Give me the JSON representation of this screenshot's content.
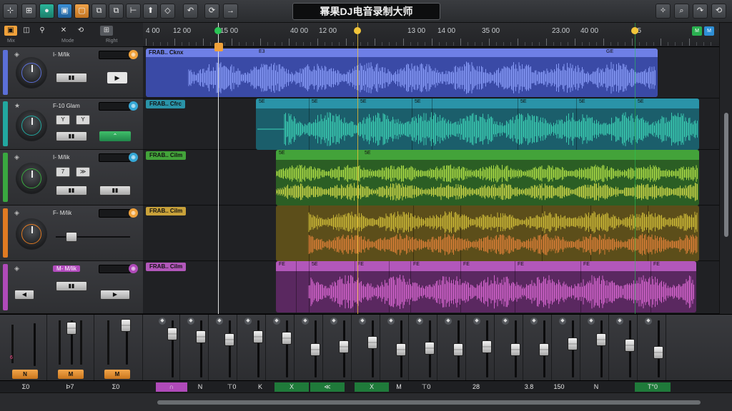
{
  "app": {
    "title": "幂果DJ电音录制大师"
  },
  "toolbar": {
    "left_buttons": [
      {
        "name": "cursor-tool",
        "glyph": "⊹"
      },
      {
        "name": "mixer-tool",
        "glyph": "⊞"
      },
      {
        "name": "record-tool",
        "glyph": "●"
      },
      {
        "name": "video-tool",
        "glyph": "▣"
      },
      {
        "name": "loop-tool",
        "glyph": "▢"
      },
      {
        "name": "copy-tool",
        "glyph": "⧉"
      },
      {
        "name": "paste-tool",
        "glyph": "⧉"
      },
      {
        "name": "split-tool",
        "glyph": "⊢"
      },
      {
        "name": "pin-tool",
        "glyph": "⬆"
      },
      {
        "name": "tag-tool",
        "glyph": "◇"
      },
      {
        "name": "rewind-tool",
        "glyph": "↶"
      },
      {
        "name": "sync-tool",
        "glyph": "⟳"
      },
      {
        "name": "forward-tool",
        "glyph": "→"
      }
    ],
    "right_buttons": [
      {
        "name": "marker-right",
        "glyph": "✧"
      },
      {
        "name": "zoom-right",
        "glyph": "⌕"
      },
      {
        "name": "redo-right",
        "glyph": "↷"
      },
      {
        "name": "undo-right",
        "glyph": "⟲"
      }
    ]
  },
  "header_bar": {
    "labels": [
      "Mix",
      "Mode",
      "Right"
    ]
  },
  "ruler": {
    "labels": [
      "4 00",
      "12 00",
      "15 00",
      "40 00",
      "12 00",
      "13 00",
      "14 00",
      "35 00",
      "23.00",
      "40 00",
      "45"
    ]
  },
  "tracks": [
    {
      "name": "I- M/lik",
      "color": "#5b6fd8",
      "field_badge": "⊕",
      "badge_color": "#f0a13a",
      "clip_label": "FRAB.. Cknx",
      "clip_color": "#5b6fd8",
      "clip_head_color": "#6e7fe6",
      "wave_color": "#8fa2ff"
    },
    {
      "name": "F-10 Glam",
      "color": "#22a8a0",
      "field_badge": "⊕",
      "badge_color": "#36a8d6",
      "clip_label": "FRAB.. Cfrc",
      "clip_color": "#1e6a78",
      "clip_head_color": "#2a93a8",
      "wave_color": "#3ed6b8"
    },
    {
      "name": "I- M/lik",
      "color": "#3aa840",
      "field_badge": "⊕",
      "badge_color": "#36a8d6",
      "clip_label": "FRAB.. Cilm",
      "clip_color": "#2d6e2a",
      "clip_head_color": "#43a33a",
      "wave_color": "#a8e04a"
    },
    {
      "name": "F- M/lik",
      "color": "#e07a22",
      "field_badge": "⊕",
      "badge_color": "#f0a13a",
      "clip_label": "FRAB.. Cilm",
      "clip_color": "#6e5c1e",
      "clip_head_color": "#c9a23a",
      "wave_color": "#e09a2a"
    },
    {
      "name": "M- M/lik",
      "color": "#b04ab9",
      "field_badge": "⊕",
      "badge_color": "#b04ab9",
      "clip_label": "FRAB.. Cilm",
      "clip_color": "#6a2d6e",
      "clip_head_color": "#b257ba",
      "wave_color": "#e06ad8"
    }
  ],
  "track_buttons": {
    "t1_play": "▶",
    "t2_b1": "Y",
    "t2_b2": "Y",
    "t2_green": "⌃",
    "t3_b1": "7",
    "t3_b2": "≫",
    "t5_b1": "◀",
    "t5_b2": "▶"
  },
  "clip_segments": {
    "t1": [
      "E3",
      "GE"
    ],
    "t2": [
      "5E",
      "5E",
      "5E",
      "5E",
      "5E",
      "5E",
      "5E"
    ],
    "t3": [
      "5E",
      "5E"
    ],
    "t5": [
      "FE",
      "5E",
      "FE",
      "FE",
      "FE",
      "FE",
      "FE",
      "FE"
    ]
  },
  "mixer": {
    "left_channels": [
      {
        "label": "N",
        "number": "6"
      },
      {
        "label": "M",
        "number": "M"
      },
      {
        "label": "M",
        "number": "M"
      }
    ],
    "bottom_labels": [
      "Σ0",
      "Þ7",
      "Σ0",
      "∩",
      "N",
      "⊤0",
      "K",
      "X",
      "≪",
      "X",
      "M",
      "⊤0",
      "28",
      "3.8",
      "150",
      "N",
      "T°0"
    ]
  },
  "markers": [
    {
      "pos_pct": 0.128,
      "color": "#2ac455"
    },
    {
      "pos_pct": 0.372,
      "color": "#f2c53a"
    },
    {
      "pos_pct": 0.852,
      "color": "#f2c53a"
    }
  ],
  "corner": {
    "btn1": "M",
    "btn2": "M"
  }
}
